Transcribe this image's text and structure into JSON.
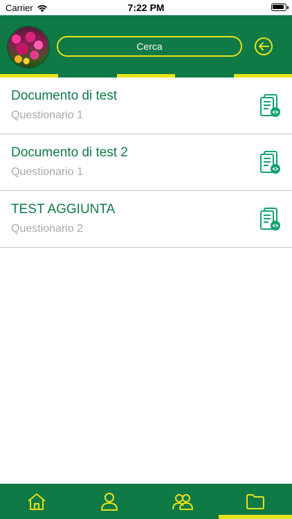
{
  "status_bar": {
    "carrier": "Carrier",
    "time": "7:22 PM"
  },
  "header": {
    "search_placeholder": "Cerca",
    "accent_color": "#e8e11a",
    "background_color": "#0f7a45"
  },
  "documents": [
    {
      "title": "Documento di test",
      "subtitle": "Questionario 1",
      "icon": "document-view-icon"
    },
    {
      "title": "Documento di test 2",
      "subtitle": "Questionario 1",
      "icon": "document-view-icon"
    },
    {
      "title": "TEST AGGIUNTA",
      "subtitle": "Questionario 2",
      "icon": "document-view-icon"
    }
  ],
  "bottom_tabs": [
    {
      "icon": "home-icon",
      "active": false
    },
    {
      "icon": "user-icon",
      "active": false
    },
    {
      "icon": "users-icon",
      "active": false
    },
    {
      "icon": "folder-icon",
      "active": true
    }
  ]
}
